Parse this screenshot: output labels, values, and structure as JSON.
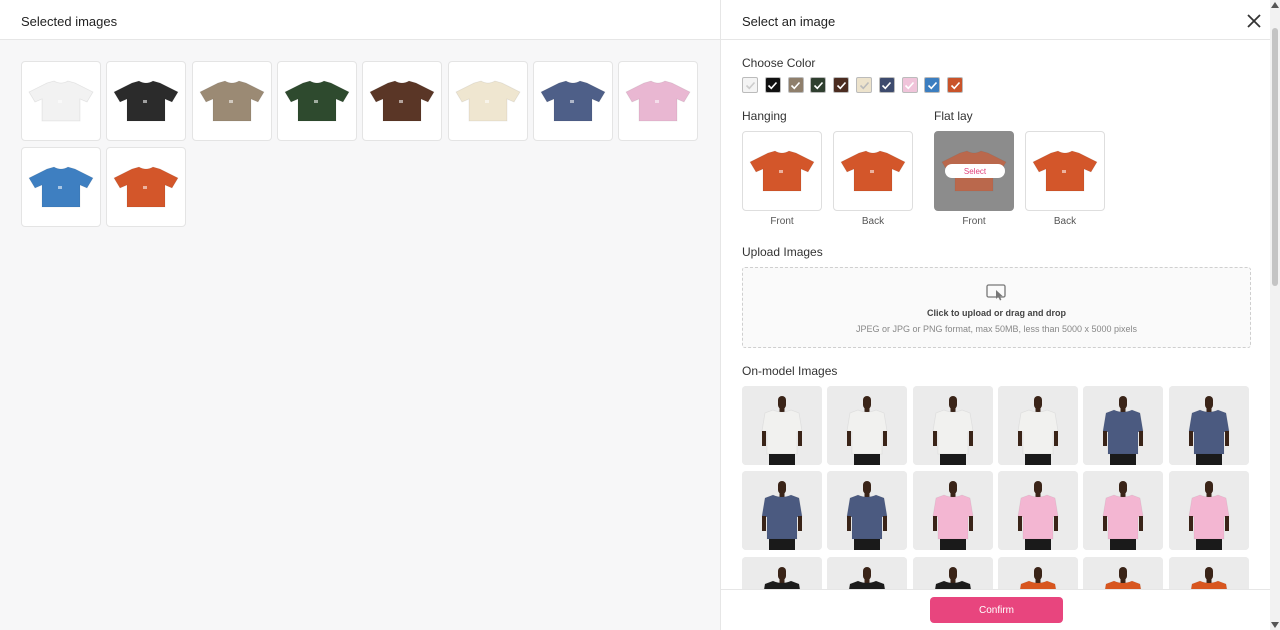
{
  "left": {
    "title": "Selected images",
    "tiles": [
      {
        "color": "#f2f2f2"
      },
      {
        "color": "#2b2b2b"
      },
      {
        "color": "#9b8a74"
      },
      {
        "color": "#2e4a2e"
      },
      {
        "color": "#5a3626"
      },
      {
        "color": "#efe6d0"
      },
      {
        "color": "#4e5f88"
      },
      {
        "color": "#e9b7d2"
      },
      {
        "color": "#3e7fc1"
      },
      {
        "color": "#d3562a"
      }
    ]
  },
  "right": {
    "title": "Select an image",
    "choose_color_label": "Choose Color",
    "swatches": [
      {
        "color": "#f4f4f4",
        "check": "#cccccc"
      },
      {
        "color": "#111111",
        "check": "#ffffff"
      },
      {
        "color": "#8f7f6c",
        "check": "#ffffff"
      },
      {
        "color": "#2f3f2f",
        "check": "#ffffff"
      },
      {
        "color": "#4b2c20",
        "check": "#ffffff"
      },
      {
        "color": "#ede3cc",
        "check": "#bbbbbb"
      },
      {
        "color": "#3e4b6e",
        "check": "#ffffff"
      },
      {
        "color": "#f0c4da",
        "check": "#ffffff"
      },
      {
        "color": "#3c7ec0",
        "check": "#ffffff"
      },
      {
        "color": "#c9532a",
        "check": "#ffffff"
      }
    ],
    "hanging_label": "Hanging",
    "flatlay_label": "Flat lay",
    "front_label": "Front",
    "back_label": "Back",
    "select_label": "Select",
    "product_color": "#d3562a",
    "upload_label": "Upload Images",
    "upload_line1": "Click to upload or drag and drop",
    "upload_line2": "JPEG or JPG or PNG format, max 50MB, less than 5000 x 5000 pixels",
    "onmodel_label": "On-model Images",
    "model_rows": [
      [
        "#f1f1ef",
        "#f1f1ef",
        "#f1f1ef",
        "#f1f1ef",
        "#4b5a80",
        "#4b5a80"
      ],
      [
        "#4b5a80",
        "#4b5a80",
        "#f3b6d2",
        "#f3b6d2",
        "#f3b6d2",
        "#f3b6d2"
      ],
      [
        "#1c1c1c",
        "#1c1c1c",
        "#1c1c1c",
        "#d8561f",
        "#d8561f",
        "#d8561f"
      ]
    ],
    "confirm_label": "Confirm"
  }
}
